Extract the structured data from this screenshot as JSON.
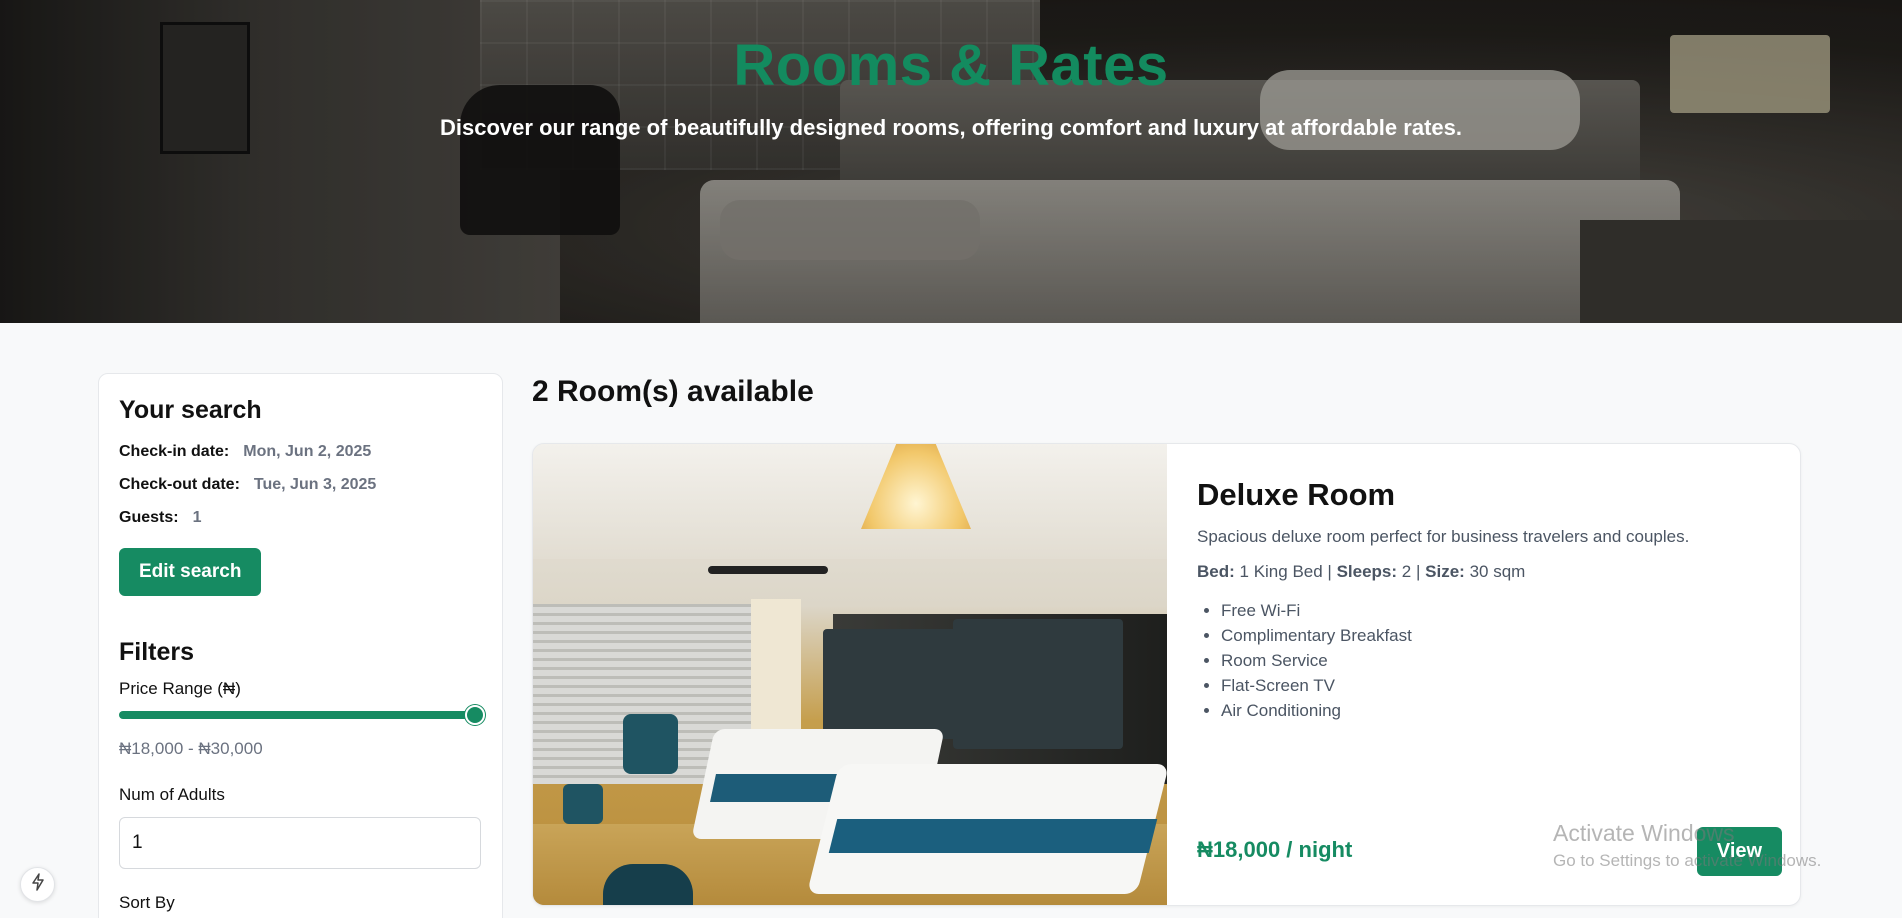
{
  "hero": {
    "title": "Rooms & Rates",
    "subtitle": "Discover our range of beautifully designed rooms, offering comfort and luxury at affordable rates."
  },
  "search": {
    "title": "Your search",
    "checkin_label": "Check-in date:",
    "checkin_value": "Mon, Jun 2, 2025",
    "checkout_label": "Check-out date:",
    "checkout_value": "Tue, Jun 3, 2025",
    "guests_label": "Guests:",
    "guests_value": "1",
    "edit_button": "Edit search"
  },
  "filters": {
    "title": "Filters",
    "price_label": "Price Range (₦)",
    "price_range_text": "₦18,000 - ₦30,000",
    "price_slider_fraction": 1.0,
    "adults_label": "Num of Adults",
    "adults_value": "1",
    "sort_label": "Sort By"
  },
  "results": {
    "count_text": "2 Room(s) available"
  },
  "room": {
    "name": "Deluxe Room",
    "description": "Spacious deluxe room perfect for business travelers and couples.",
    "bed_label": "Bed:",
    "bed_value": "1 King Bed",
    "sleeps_label": "Sleeps:",
    "sleeps_value": "2",
    "size_label": "Size:",
    "size_value": "30 sqm",
    "amenities": [
      "Free Wi-Fi",
      "Complimentary Breakfast",
      "Room Service",
      "Flat-Screen TV",
      "Air Conditioning"
    ],
    "price": "₦18,000 / night",
    "view_button": "View"
  },
  "watermark": {
    "line1": "Activate Windows",
    "line2": "Go to Settings to activate Windows."
  },
  "fab_icon": "lightning-icon",
  "colors": {
    "accent": "#168b62",
    "muted_text": "#6b7280",
    "page_bg": "#f8f9fa"
  }
}
